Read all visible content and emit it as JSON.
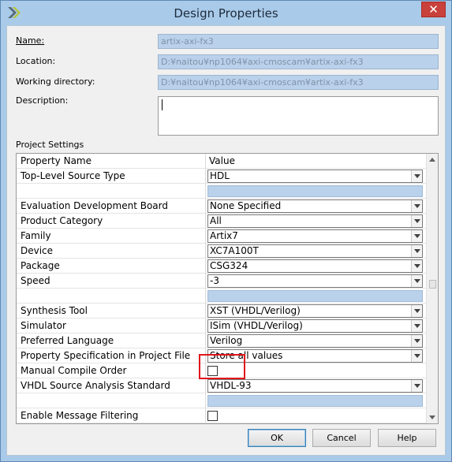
{
  "window": {
    "title": "Design Properties",
    "close_glyph": "✕"
  },
  "fields": {
    "name_label": "Name:",
    "name_value": "artix-axi-fx3",
    "location_label": "Location:",
    "location_value": "D:¥naitou¥np1064¥axi-cmoscam¥artix-axi-fx3",
    "working_dir_label": "Working directory:",
    "working_dir_value": "D:¥naitou¥np1064¥axi-cmoscam¥artix-axi-fx3",
    "description_label": "Description:",
    "description_value": ""
  },
  "project_settings_label": "Project Settings",
  "grid": {
    "header": {
      "name": "Property Name",
      "value": "Value"
    },
    "rows": [
      {
        "name": "Top-Level Source Type",
        "kind": "combo",
        "value": "HDL"
      },
      {
        "name": "",
        "kind": "blank",
        "value": ""
      },
      {
        "name": "Evaluation Development Board",
        "kind": "combo",
        "value": "None Specified"
      },
      {
        "name": "Product Category",
        "kind": "combo",
        "value": "All"
      },
      {
        "name": "Family",
        "kind": "combo",
        "value": "Artix7"
      },
      {
        "name": "Device",
        "kind": "combo",
        "value": "XC7A100T"
      },
      {
        "name": "Package",
        "kind": "combo",
        "value": "CSG324"
      },
      {
        "name": "Speed",
        "kind": "combo",
        "value": "-3"
      },
      {
        "name": "",
        "kind": "blank",
        "value": ""
      },
      {
        "name": "Synthesis Tool",
        "kind": "combo",
        "value": "XST (VHDL/Verilog)"
      },
      {
        "name": "Simulator",
        "kind": "combo",
        "value": "ISim (VHDL/Verilog)"
      },
      {
        "name": "Preferred Language",
        "kind": "combo",
        "value": "Verilog"
      },
      {
        "name": "Property Specification in Project File",
        "kind": "combo",
        "value": "Store all values"
      },
      {
        "name": "Manual Compile Order",
        "kind": "checkbox",
        "value": ""
      },
      {
        "name": "VHDL Source Analysis Standard",
        "kind": "combo",
        "value": "VHDL-93"
      },
      {
        "name": "",
        "kind": "blank",
        "value": ""
      },
      {
        "name": "Enable Message Filtering",
        "kind": "checkbox",
        "value": ""
      }
    ]
  },
  "buttons": {
    "ok": "OK",
    "cancel": "Cancel",
    "help": "Help"
  },
  "colors": {
    "accent_blue": "#b9d1ea",
    "highlight_red": "#e2161b",
    "close_red": "#c8413b"
  }
}
